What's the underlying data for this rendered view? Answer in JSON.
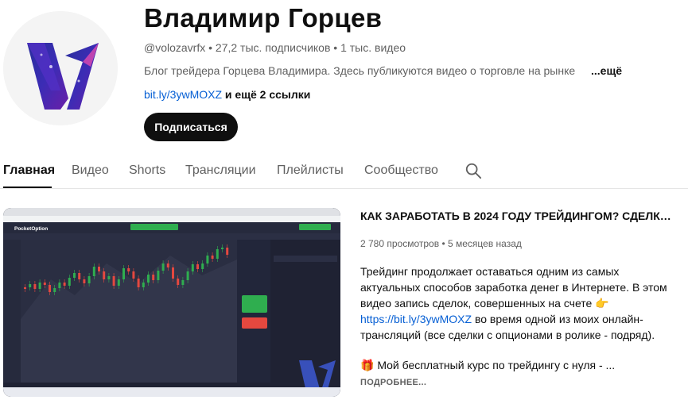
{
  "channel": {
    "name": "Владимир Горцев",
    "handle": "@volozavrfx",
    "subscribers": "27,2 тыс. подписчиков",
    "videos": "1 тыс. видео",
    "separator": "•",
    "description": "Блог трейдера Горцева Владимира. Здесь публикуются видео о торговле на рынке",
    "more_label": "...ещё",
    "link": "bit.ly/3ywMOXZ",
    "extra_links": "и ещё 2 ссылки",
    "subscribe_label": "Подписаться"
  },
  "tabs": [
    {
      "label": "Главная",
      "active": true
    },
    {
      "label": "Видео"
    },
    {
      "label": "Shorts"
    },
    {
      "label": "Трансляции"
    },
    {
      "label": "Плейлисты"
    },
    {
      "label": "Сообщество"
    }
  ],
  "video": {
    "title": "КАК ЗАРАБОТАТЬ В 2024 ГОДУ ТРЕЙДИНГОМ? СДЕЛКИ О...",
    "views": "2 780 просмотров",
    "age": "5 месяцев назад",
    "desc_lines": [
      "Трейдинг продолжает оставаться одним из самых",
      "актуальных способов заработка денег в Интернете. В этом",
      "видео запись сделок, совершенных на счете"
    ],
    "desc_link": "https://bit.ly/3ywMOXZ",
    "desc_after_link": "во время одной из моих онлайн-",
    "desc_last": "трансляций (все сделки с опционами в ролике - подряд).",
    "gift_text": "Мой бесплатный курс по трейдингу с нуля - ...",
    "read_more": "ПОДРОБНЕЕ..."
  },
  "thumbnail": {
    "brand": "PocketOption",
    "colors": {
      "up": "#2fae4f",
      "down": "#e5483f",
      "bg": "#1f2233"
    }
  }
}
